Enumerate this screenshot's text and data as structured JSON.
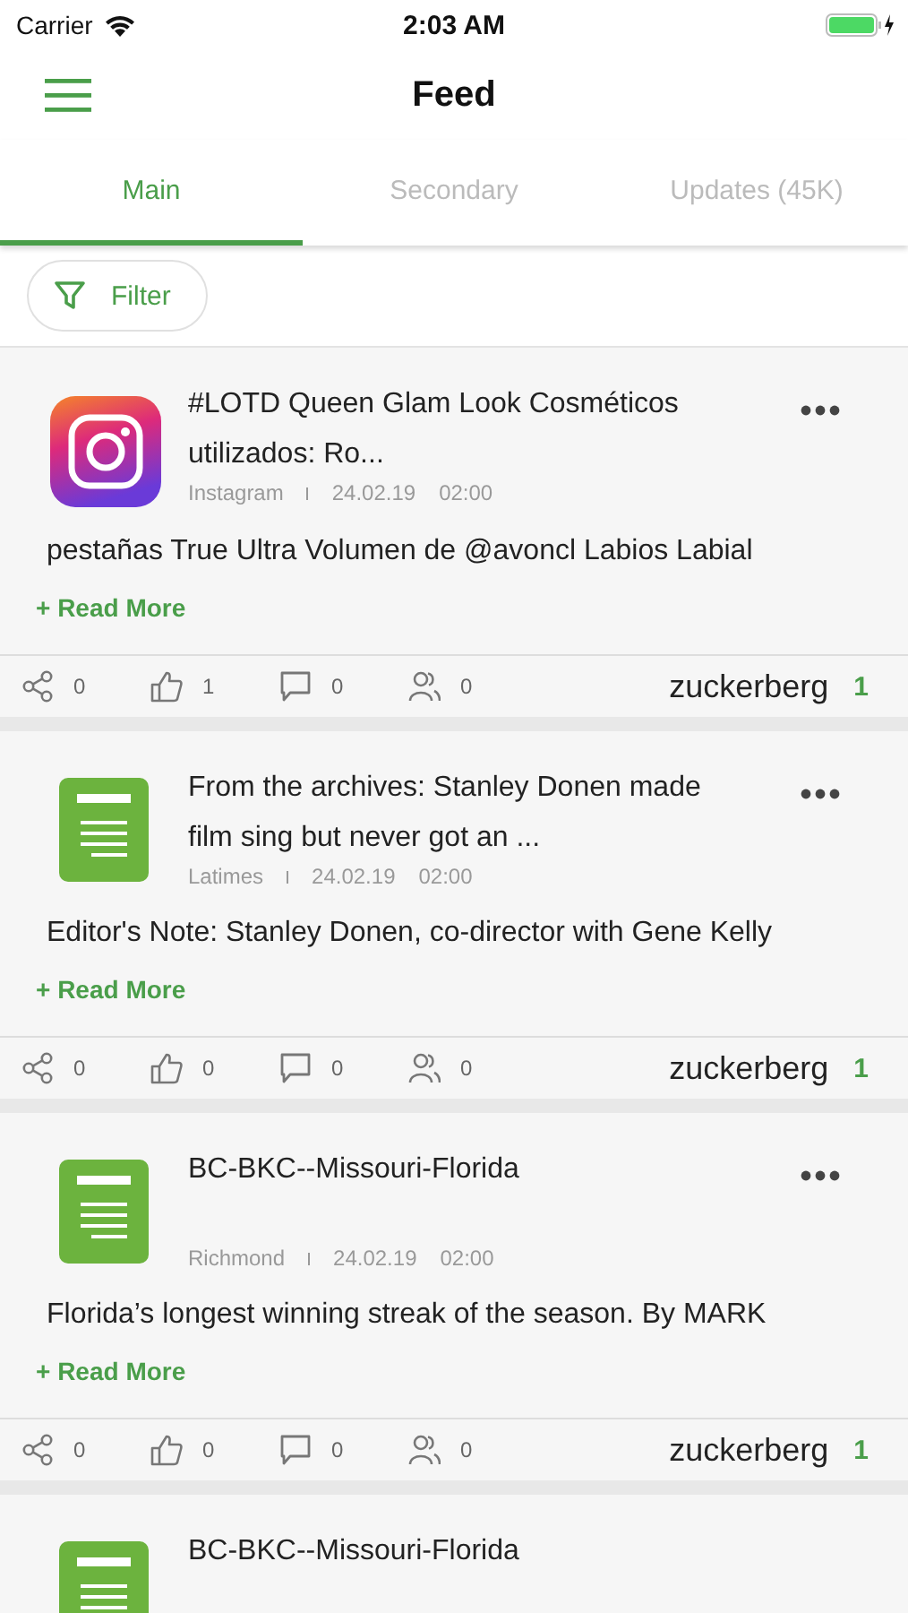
{
  "status_bar": {
    "carrier": "Carrier",
    "time": "2:03 AM"
  },
  "nav": {
    "title": "Feed"
  },
  "tabs": [
    {
      "label": "Main",
      "selected": true
    },
    {
      "label": "Secondary",
      "selected": false
    },
    {
      "label": "Updates (45K)",
      "selected": false
    }
  ],
  "filter": {
    "label": "Filter"
  },
  "posts": [
    {
      "kind": "instagram",
      "title": "#LOTD Queen Glam Look Cosméticos utilizados: Ro...",
      "source": "Instagram",
      "date": "24.02.19",
      "time": "02:00",
      "body": "pestañas True Ultra Volumen de @avoncl Labios Labial",
      "read_more": "+ Read More",
      "shares": "0",
      "likes": "1",
      "comments": "0",
      "people": "0",
      "author": "zuckerberg",
      "author_count": "1"
    },
    {
      "kind": "document",
      "title": "From the archives: Stanley Donen made film sing but never got an ...",
      "source": "Latimes",
      "date": "24.02.19",
      "time": "02:00",
      "body": "Editor's Note: Stanley Donen, co-director with Gene Kelly",
      "read_more": "+ Read More",
      "shares": "0",
      "likes": "0",
      "comments": "0",
      "people": "0",
      "author": "zuckerberg",
      "author_count": "1"
    },
    {
      "kind": "document",
      "title": "BC-BKC--Missouri-Florida",
      "source": "Richmond",
      "date": "24.02.19",
      "time": "02:00",
      "body": "Florida’s longest winning streak of the season. By MARK",
      "read_more": "+ Read More",
      "shares": "0",
      "likes": "0",
      "comments": "0",
      "people": "0",
      "author": "zuckerberg",
      "author_count": "1"
    },
    {
      "kind": "document",
      "title": "BC-BKC--Missouri-Florida"
    }
  ]
}
